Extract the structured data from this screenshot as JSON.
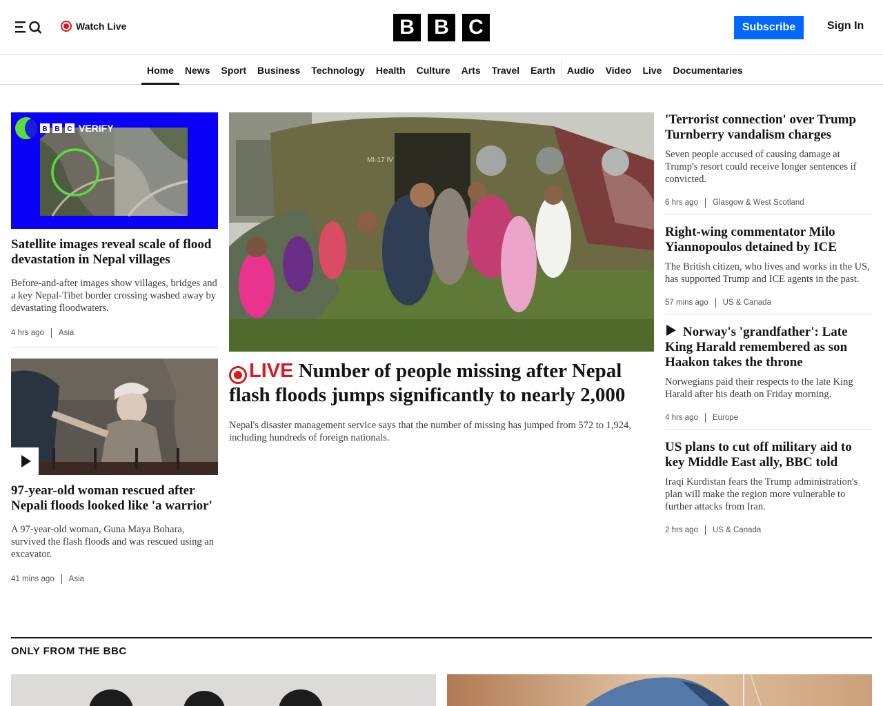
{
  "header": {
    "watch_live": "Watch Live",
    "logo_letters": [
      "B",
      "B",
      "C"
    ],
    "subscribe": "Subscribe",
    "sign_in": "Sign In"
  },
  "nav": {
    "items": [
      "Home",
      "News",
      "Sport",
      "Business",
      "Technology",
      "Health",
      "Culture",
      "Arts",
      "Travel",
      "Earth",
      "Audio",
      "Video",
      "Live",
      "Documentaries"
    ],
    "active": "Home"
  },
  "left": [
    {
      "image_badge": "BBC VERIFY",
      "headline": "Satellite images reveal scale of flood devastation in Nepal villages",
      "summary": "Before-and-after images show villages, bridges and a key Nepal-Tibet border crossing washed away by devastating floodwaters.",
      "time": "4 hrs ago",
      "section": "Asia"
    },
    {
      "headline": "97-year-old woman rescued after Nepali floods looked like 'a warrior'",
      "summary": "A 97-year-old woman, Guna Maya Bohara, survived the flash floods and was rescued using an excavator.",
      "time": "41 mins ago",
      "section": "Asia"
    }
  ],
  "main": {
    "image_text": "MI-17 IV",
    "live_label": "LIVE",
    "headline": "Number of people missing after Nepal flash floods jumps significantly to nearly 2,000",
    "summary": "Nepal's disaster management service says that the number of missing has jumped from 572 to 1,924, including hundreds of foreign nationals."
  },
  "right": [
    {
      "headline": "'Terrorist connection' over Trump Turnberry vandalism charges",
      "summary": "Seven people accused of causing damage at Trump's resort could receive longer sentences if convicted.",
      "time": "6 hrs ago",
      "section": "Glasgow & West Scotland"
    },
    {
      "headline": "Right-wing commentator Milo Yiannopoulos detained by ICE",
      "summary": "The British citizen, who lives and works in the US, has supported Trump and ICE agents in the past.",
      "time": "57 mins ago",
      "section": "US & Canada"
    },
    {
      "headline": "Norway's 'grandfather': Late King Harald remembered as son Haakon takes the throne",
      "summary": "Norwegians paid their respects to the late King Harald after his death on Friday morning.",
      "time": "4 hrs ago",
      "section": "Europe"
    },
    {
      "headline": "US plans to cut off military aid to key Middle East ally, BBC told",
      "summary": "Iraqi Kurdistan fears the Trump administration's plan will make the region more vulnerable to further attacks from Iran.",
      "time": "2 hrs ago",
      "section": "US & Canada"
    }
  ],
  "section": {
    "title": "ONLY FROM THE BBC"
  },
  "colors": {
    "accent_blue": "#0068ff",
    "live_red": "#d71920",
    "verify_blue": "#0a00f5",
    "verify_green": "#5adc3c"
  }
}
